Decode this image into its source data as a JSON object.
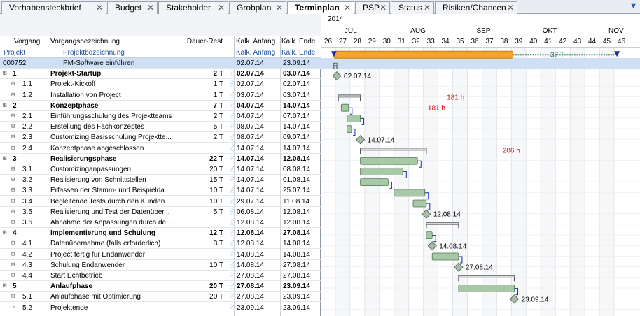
{
  "tabs": [
    {
      "label": "Vorhabensteckbrief",
      "active": false
    },
    {
      "label": "Budget",
      "active": false
    },
    {
      "label": "Stakeholder",
      "active": false
    },
    {
      "label": "Grobplan",
      "active": false
    },
    {
      "label": "Terminplan",
      "active": true
    },
    {
      "label": "PSP",
      "active": false
    },
    {
      "label": "Status",
      "active": false
    },
    {
      "label": "Risiken/Chancen",
      "active": false
    }
  ],
  "columns": {
    "vorgang": "Vorgang",
    "bezeichnung": "Vorgangsbezeichnung",
    "dauer_rest": "Dauer-Rest",
    "dots": "..",
    "kalk_anfang": "Kalk. Anfang",
    "kalk_ende": "Kalk. Ende",
    "projekt": "Projekt",
    "projektbezeichnung": "Projektbezeichnung",
    "kalk_anfang2": "Kalk. Anfang",
    "kalk_ende2": "Kalk. Ende"
  },
  "rows": [
    {
      "id": "000752",
      "name": "PM-Software einführen",
      "dur": "",
      "start": "02.07.14",
      "end": "23.09.14",
      "type": "project",
      "level": 0
    },
    {
      "id": "1",
      "name": "Projekt-Startup",
      "dur": "2 T",
      "start": "02.07.14",
      "end": "03.07.14",
      "type": "summary",
      "level": 1
    },
    {
      "id": "1.1",
      "name": "Projekt-Kickoff",
      "dur": "1 T",
      "start": "02.07.14",
      "end": "02.07.14",
      "type": "task",
      "level": 2
    },
    {
      "id": "1.2",
      "name": "Installation von Project",
      "dur": "1 T",
      "start": "03.07.14",
      "end": "03.07.14",
      "type": "task",
      "level": 2
    },
    {
      "id": "2",
      "name": "Konzeptphase",
      "dur": "7 T",
      "start": "04.07.14",
      "end": "14.07.14",
      "type": "summary",
      "level": 1
    },
    {
      "id": "2.1",
      "name": "Einführungsschulung des Projektteams",
      "dur": "2 T",
      "start": "04.07.14",
      "end": "07.07.14",
      "type": "task",
      "level": 2
    },
    {
      "id": "2.2",
      "name": "Erstellung des Fachkonzeptes",
      "dur": "5 T",
      "start": "08.07.14",
      "end": "14.07.14",
      "type": "task",
      "level": 2
    },
    {
      "id": "2.3",
      "name": "Customizing Basisschulung Projektte...",
      "dur": "2 T",
      "start": "08.07.14",
      "end": "09.07.14",
      "type": "task",
      "level": 2
    },
    {
      "id": "2.4",
      "name": "Konzeptphase abgeschlossen",
      "dur": "",
      "start": "14.07.14",
      "end": "14.07.14",
      "type": "task",
      "level": 2
    },
    {
      "id": "3",
      "name": "Realisierungsphase",
      "dur": "22 T",
      "start": "14.07.14",
      "end": "12.08.14",
      "type": "summary",
      "level": 1
    },
    {
      "id": "3.1",
      "name": "Customizinganpassungen",
      "dur": "20 T",
      "start": "14.07.14",
      "end": "08.08.14",
      "type": "task",
      "level": 2
    },
    {
      "id": "3.2",
      "name": "Realisierung von Schnittstellen",
      "dur": "15 T",
      "start": "14.07.14",
      "end": "01.08.14",
      "type": "task",
      "level": 2
    },
    {
      "id": "3.3",
      "name": "Erfassen der Stamm- und Beispielda...",
      "dur": "10 T",
      "start": "14.07.14",
      "end": "25.07.14",
      "type": "task",
      "level": 2
    },
    {
      "id": "3.4",
      "name": "Begleitende Tests durch den Kunden",
      "dur": "10 T",
      "start": "29.07.14",
      "end": "11.08.14",
      "type": "task",
      "level": 2
    },
    {
      "id": "3.5",
      "name": "Realisierung und Test der Datenüber...",
      "dur": "5 T",
      "start": "06.08.14",
      "end": "12.08.14",
      "type": "task",
      "level": 2
    },
    {
      "id": "3.6",
      "name": "Abnahme der Anpassungen durch de...",
      "dur": "",
      "start": "12.08.14",
      "end": "12.08.14",
      "type": "task",
      "level": 2
    },
    {
      "id": "4",
      "name": "Implementierung und Schulung",
      "dur": "12 T",
      "start": "12.08.14",
      "end": "27.08.14",
      "type": "summary",
      "level": 1
    },
    {
      "id": "4.1",
      "name": "Datenübernahme (falls erforderlich)",
      "dur": "3 T",
      "start": "12.08.14",
      "end": "14.08.14",
      "type": "task",
      "level": 2
    },
    {
      "id": "4.2",
      "name": "Project fertig für Endanwender",
      "dur": "",
      "start": "14.08.14",
      "end": "14.08.14",
      "type": "task",
      "level": 2
    },
    {
      "id": "4.3",
      "name": "Schulung Endanwender",
      "dur": "10 T",
      "start": "14.08.14",
      "end": "27.08.14",
      "type": "task",
      "level": 2
    },
    {
      "id": "4.4",
      "name": "Start Echtbetrieb",
      "dur": "",
      "start": "27.08.14",
      "end": "27.08.14",
      "type": "task",
      "level": 2
    },
    {
      "id": "5",
      "name": "Anlaufphase",
      "dur": "20 T",
      "start": "27.08.14",
      "end": "23.09.14",
      "type": "summary",
      "level": 1
    },
    {
      "id": "5.1",
      "name": "Anlaufphase mit Optimierung",
      "dur": "20 T",
      "start": "27.08.14",
      "end": "23.09.14",
      "type": "task",
      "level": 2
    },
    {
      "id": "5.2",
      "name": "Projektende",
      "dur": "",
      "start": "23.09.14",
      "end": "23.09.14",
      "type": "task",
      "level": 2
    }
  ],
  "timeline": {
    "year": "2014",
    "months": [
      {
        "label": "JUL",
        "week": 28
      },
      {
        "label": "AUG",
        "week": 32.5
      },
      {
        "label": "SEP",
        "week": 37
      },
      {
        "label": "OKT",
        "week": 41.5
      },
      {
        "label": "NOV",
        "week": 46
      }
    ],
    "weeks": [
      26,
      27,
      28,
      29,
      30,
      31,
      32,
      33,
      34,
      35,
      36,
      37,
      38,
      39,
      40,
      41,
      42,
      43,
      44,
      45,
      46
    ]
  },
  "bars": [
    {
      "row": 0,
      "kind": "project",
      "start": 26.9,
      "end": 39.1
    },
    {
      "row": 0,
      "kind": "dashed",
      "start": 39.1,
      "end": 46.2
    },
    {
      "row": 1,
      "kind": "summary",
      "start": 26.9,
      "end": 27.1
    },
    {
      "row": 2,
      "kind": "milestone",
      "start": 27.1,
      "label": "02.07.14"
    },
    {
      "row": 4,
      "kind": "summary",
      "start": 27.2,
      "end": 28.7
    },
    {
      "row": 5,
      "kind": "task",
      "start": 27.4,
      "end": 27.9
    },
    {
      "row": 6,
      "kind": "task",
      "start": 27.8,
      "end": 28.7
    },
    {
      "row": 7,
      "kind": "task",
      "start": 27.8,
      "end": 28.1
    },
    {
      "row": 8,
      "kind": "milestone",
      "start": 28.7,
      "label": "14.07.14"
    },
    {
      "row": 9,
      "kind": "summary",
      "start": 28.7,
      "end": 33.2
    },
    {
      "row": 10,
      "kind": "task",
      "start": 28.7,
      "end": 32.6
    },
    {
      "row": 11,
      "kind": "task",
      "start": 28.7,
      "end": 31.6
    },
    {
      "row": 12,
      "kind": "task",
      "start": 28.7,
      "end": 30.6
    },
    {
      "row": 13,
      "kind": "task",
      "start": 31.0,
      "end": 33.1
    },
    {
      "row": 14,
      "kind": "task",
      "start": 32.3,
      "end": 33.2
    },
    {
      "row": 15,
      "kind": "milestone",
      "start": 33.2,
      "label": "12.08.14"
    },
    {
      "row": 16,
      "kind": "summary",
      "start": 33.2,
      "end": 35.4
    },
    {
      "row": 17,
      "kind": "task",
      "start": 33.2,
      "end": 33.6
    },
    {
      "row": 18,
      "kind": "milestone",
      "start": 33.6,
      "label": "14.08.14"
    },
    {
      "row": 19,
      "kind": "task",
      "start": 33.6,
      "end": 35.4
    },
    {
      "row": 20,
      "kind": "milestone",
      "start": 35.4,
      "label": "27.08.14"
    },
    {
      "row": 21,
      "kind": "summary",
      "start": 35.4,
      "end": 39.2
    },
    {
      "row": 22,
      "kind": "task",
      "start": 35.4,
      "end": 39.2
    },
    {
      "row": 23,
      "kind": "milestone",
      "start": 39.2,
      "label": "23.09.14"
    }
  ],
  "annotations": [
    {
      "row": 0,
      "week": 41.5,
      "text": "-37 T",
      "color": "#0a7a6a"
    },
    {
      "row": 4,
      "week": 34.6,
      "text": "181 h",
      "color": "#cc1111"
    },
    {
      "row": 5,
      "week": 33.3,
      "text": "181 h",
      "color": "#cc1111"
    },
    {
      "row": 9,
      "week": 38.4,
      "text": "206 h",
      "color": "#cc1111"
    }
  ],
  "colors": {
    "project_bar": "#f4a62a",
    "task_fill": "#a8c8a8",
    "task_stroke": "#4d7a52",
    "summary_stroke": "#555555",
    "link": "#1a2aa8",
    "dashed": "#2e8b57",
    "arrow": "#1a2aa8"
  }
}
